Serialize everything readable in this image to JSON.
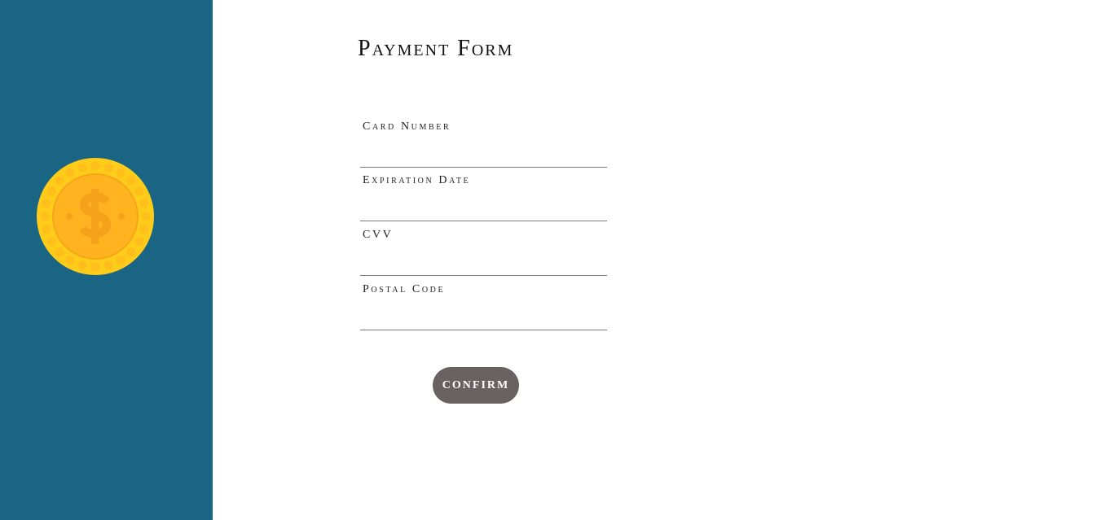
{
  "sidebar": {
    "background": "#1b6584",
    "icon": "dollar-coin-icon"
  },
  "form": {
    "title": "Payment Form",
    "fields": [
      {
        "label": "Card Number",
        "value": ""
      },
      {
        "label": "Expiration Date",
        "value": ""
      },
      {
        "label": "CVV",
        "value": ""
      },
      {
        "label": "Postal Code",
        "value": ""
      }
    ],
    "confirm_label": "confirm"
  },
  "colors": {
    "accent": "#1b6584",
    "button": "#6a6262",
    "coin_outer": "#ffcc1a",
    "coin_inner": "#ffb31f"
  }
}
